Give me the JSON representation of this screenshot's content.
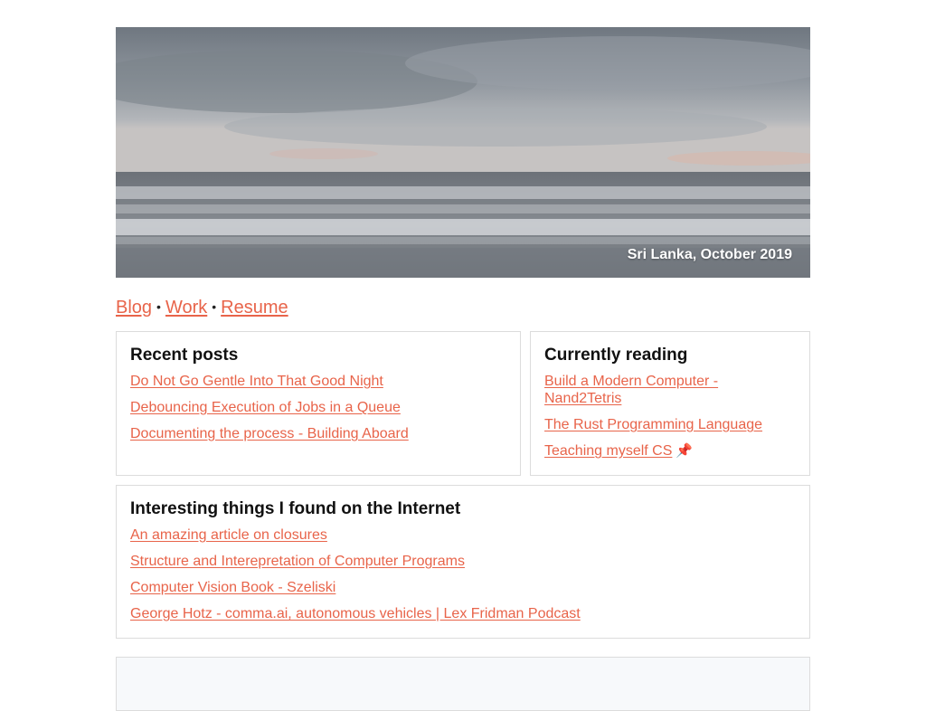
{
  "hero": {
    "caption": "Sri Lanka, October 2019",
    "image_subject": "cloudy-sky-ocean-waves"
  },
  "nav": {
    "items": [
      {
        "label": "Blog"
      },
      {
        "label": "Work"
      },
      {
        "label": "Resume"
      }
    ],
    "separator": "•"
  },
  "recent_posts": {
    "title": "Recent posts",
    "items": [
      {
        "label": "Do Not Go Gentle Into That Good Night"
      },
      {
        "label": "Debouncing Execution of Jobs in a Queue"
      },
      {
        "label": "Documenting the process - Building Aboard"
      }
    ]
  },
  "currently_reading": {
    "title": "Currently reading",
    "items": [
      {
        "label": "Build a Modern Computer - Nand2Tetris"
      },
      {
        "label": "The Rust Programming Language"
      },
      {
        "label": "Teaching myself CS",
        "icon": "pushpin-icon"
      }
    ]
  },
  "internet": {
    "title": "Interesting things I found on the Internet",
    "items": [
      {
        "label": "An amazing article on closures"
      },
      {
        "label": "Structure and Interepretation of Computer Programs"
      },
      {
        "label": "Computer Vision Book - Szeliski"
      },
      {
        "label": "George Hotz - comma.ai, autonomous vehicles | Lex Fridman Podcast"
      }
    ]
  },
  "colors": {
    "link": "#e8644a",
    "border": "#dcdcdc"
  }
}
